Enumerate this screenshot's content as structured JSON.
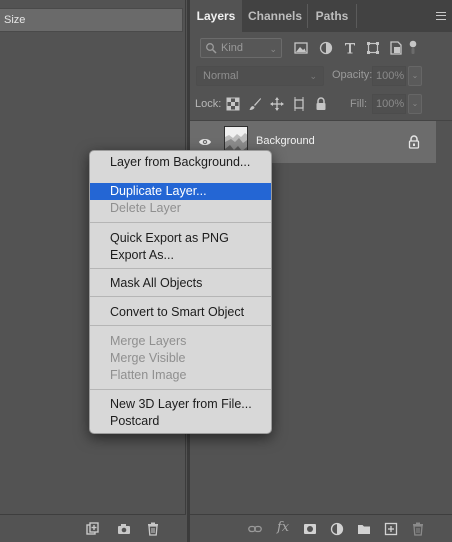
{
  "left_panel": {
    "size_label": "Size"
  },
  "layers_panel": {
    "tabs": [
      {
        "label": "Layers",
        "active": true
      },
      {
        "label": "Channels",
        "active": false
      },
      {
        "label": "Paths",
        "active": false
      }
    ],
    "filter": {
      "kind_label": "Kind",
      "icons": [
        "pixel-layer-filter-icon",
        "adjustment-layer-filter-icon",
        "type-layer-filter-icon",
        "shape-layer-filter-icon",
        "smart-object-filter-icon",
        "filter-toggle-icon"
      ]
    },
    "blend_mode": "Normal",
    "opacity_label": "Opacity:",
    "opacity_value": "100%",
    "lock_label": "Lock:",
    "fill_label": "Fill:",
    "fill_value": "100%",
    "layer": {
      "name": "Background",
      "locked": true,
      "visible": true
    },
    "footer_icons": [
      "link-layers-icon",
      "fx-icon",
      "add-mask-icon",
      "adjustment-layer-icon",
      "group-folder-icon",
      "new-layer-icon",
      "trash-icon"
    ],
    "fx_text": "fx"
  },
  "context_menu": {
    "items": [
      {
        "label": "Layer from Background...",
        "disabled": false,
        "selected": false
      },
      {
        "label": "Duplicate Layer...",
        "disabled": false,
        "selected": true
      },
      {
        "label": "Delete Layer",
        "disabled": true,
        "selected": false
      },
      {
        "label": "Quick Export as PNG",
        "disabled": false,
        "selected": false
      },
      {
        "label": "Export As...",
        "disabled": false,
        "selected": false
      },
      {
        "label": "Mask All Objects",
        "disabled": false,
        "selected": false
      },
      {
        "label": "Convert to Smart Object",
        "disabled": false,
        "selected": false
      },
      {
        "label": "Merge Layers",
        "disabled": true,
        "selected": false
      },
      {
        "label": "Merge Visible",
        "disabled": true,
        "selected": false
      },
      {
        "label": "Flatten Image",
        "disabled": true,
        "selected": false
      },
      {
        "label": "New 3D Layer from File...",
        "disabled": false,
        "selected": false
      },
      {
        "label": "Postcard",
        "disabled": false,
        "selected": false
      }
    ]
  },
  "colors": {
    "panel_bg": "#535353",
    "selected_row": "#6c6c6c",
    "menu_bg": "#d8d8d8",
    "menu_highlight": "#2466d4"
  }
}
